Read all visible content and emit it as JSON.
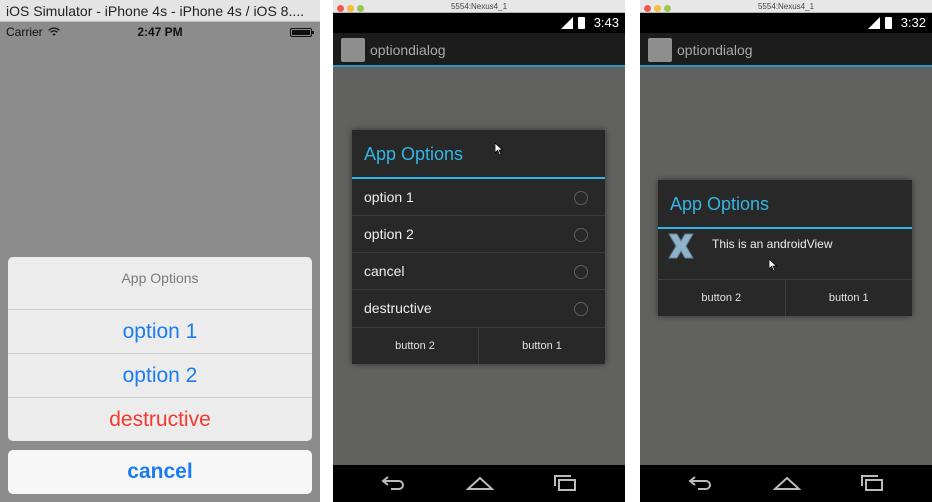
{
  "ios": {
    "window_title": "iOS Simulator - iPhone 4s - iPhone 4s / iOS 8....",
    "carrier": "Carrier",
    "time": "2:47 PM",
    "sheet": {
      "title": "App Options",
      "options": [
        "option 1",
        "option 2"
      ],
      "destructive": "destructive",
      "cancel": "cancel"
    },
    "colors": {
      "tint": "#1a7cf0",
      "destructive": "#f23a2f"
    }
  },
  "android_left": {
    "window_title": "5554:Nexus4_1",
    "time": "3:43",
    "app_title": "optiondialog",
    "dialog": {
      "title": "App Options",
      "options": [
        "option 1",
        "option 2",
        "cancel",
        "destructive"
      ],
      "button_left": "button 2",
      "button_right": "button 1"
    }
  },
  "android_right": {
    "window_title": "5554:Nexus4_1",
    "time": "3:32",
    "app_title": "optiondialog",
    "dialog": {
      "title": "App Options",
      "message": "This is an androidView",
      "button_left": "button 2",
      "button_right": "button 1"
    }
  },
  "theme": {
    "holo_blue": "#33b5e5"
  }
}
